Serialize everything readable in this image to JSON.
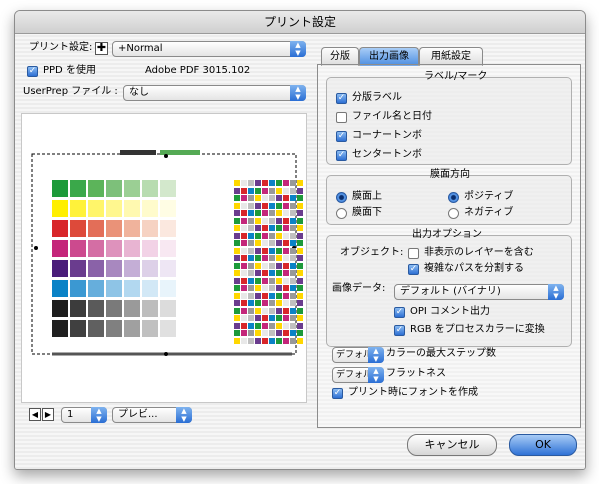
{
  "window": {
    "title": "プリント設定"
  },
  "top": {
    "preset_label": "プリント設定:",
    "preset_value": "+Normal",
    "ppd_label": "PPD を使用",
    "ppd_checked": true,
    "ppd_value": "Adobe PDF 3015.102",
    "userprep_label": "UserPrep ファイル :",
    "userprep_value": "なし"
  },
  "preview_controls": {
    "page_value": "1",
    "mode_value": "プレビ..."
  },
  "tabs": [
    {
      "label": "分版"
    },
    {
      "label": "出力画像"
    },
    {
      "label": "用紙設定"
    }
  ],
  "labels_group": {
    "title": "ラベル/マーク",
    "items": [
      {
        "label": "分版ラベル",
        "checked": true
      },
      {
        "label": "ファイル名と日付",
        "checked": false
      },
      {
        "label": "コーナートンボ",
        "checked": true
      },
      {
        "label": "センタートンボ",
        "checked": true
      }
    ]
  },
  "emulsion_group": {
    "title": "膜面方向",
    "left": [
      {
        "label": "膜面上",
        "selected": true
      },
      {
        "label": "膜面下",
        "selected": false
      }
    ],
    "right": [
      {
        "label": "ポジティブ",
        "selected": true
      },
      {
        "label": "ネガティブ",
        "selected": false
      }
    ]
  },
  "output_group": {
    "title": "出力オプション",
    "objects_label": "オブジェクト:",
    "hidden_layers": {
      "label": "非表示のレイヤーを含む",
      "checked": false
    },
    "split_paths": {
      "label": "複雑なパスを分割する",
      "checked": true
    },
    "image_data_label": "画像データ:",
    "image_data_value": "デフォルト (バイナリ)",
    "opi": {
      "label": "OPI コメント出力",
      "checked": true
    },
    "rgb": {
      "label": "RGB をプロセスカラーに変換",
      "checked": true
    }
  },
  "bottom_opts": {
    "steps_value": "デフォルト",
    "steps_label": "カラーの最大ステップ数",
    "flat_value": "デフォルト",
    "flat_label": "フラットネス",
    "font_label": "プリント時にフォントを作成",
    "font_checked": true
  },
  "buttons": {
    "cancel": "キャンセル",
    "ok": "OK"
  },
  "colors": {
    "accent": "#3a7ad8",
    "window_bg": "#ececec"
  }
}
